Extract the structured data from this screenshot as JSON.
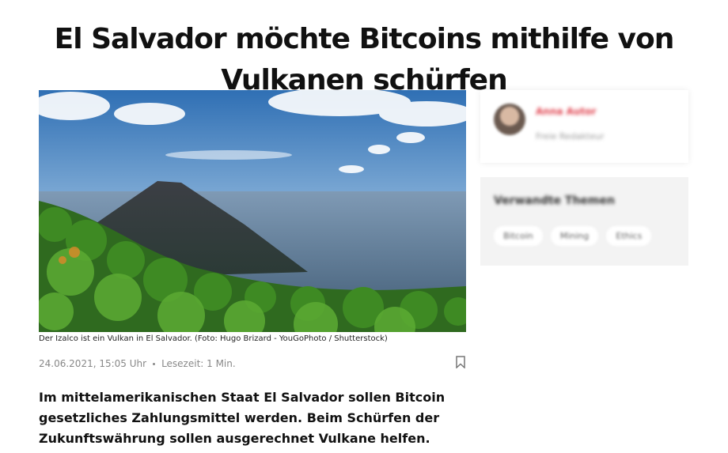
{
  "article": {
    "headline_line1": "El Salvador möchte Bitcoins mithilfe von",
    "headline_line2": "Vulkanen schürfen",
    "image_caption": "Der Izalco ist ein Vulkan in El Salvador. (Foto: Hugo Brizard - YouGoPhoto / Shutterstock)",
    "date": "24.06.2021, 15:05 Uhr",
    "read_time": "Lesezeit: 1 Min.",
    "lead_line1": "Im mittelamerikanischen Staat El Salvador sollen Bitcoin",
    "lead_line2": "gesetzliches Zahlungsmittel werden. Beim Schürfen der",
    "lead_line3": "Zukunftswährung sollen ausgerechnet Vulkane helfen."
  },
  "sidebar": {
    "author_name": "Anna Autor",
    "author_role": "Freie Redakteur",
    "topics_title": "Verwandte Themen",
    "topics": [
      "Bitcoin",
      "Mining",
      "Ethics"
    ]
  },
  "colors": {
    "author_accent": "#e0434f",
    "meta_text": "#888888"
  },
  "icons": {
    "bookmark": "bookmark-icon"
  }
}
